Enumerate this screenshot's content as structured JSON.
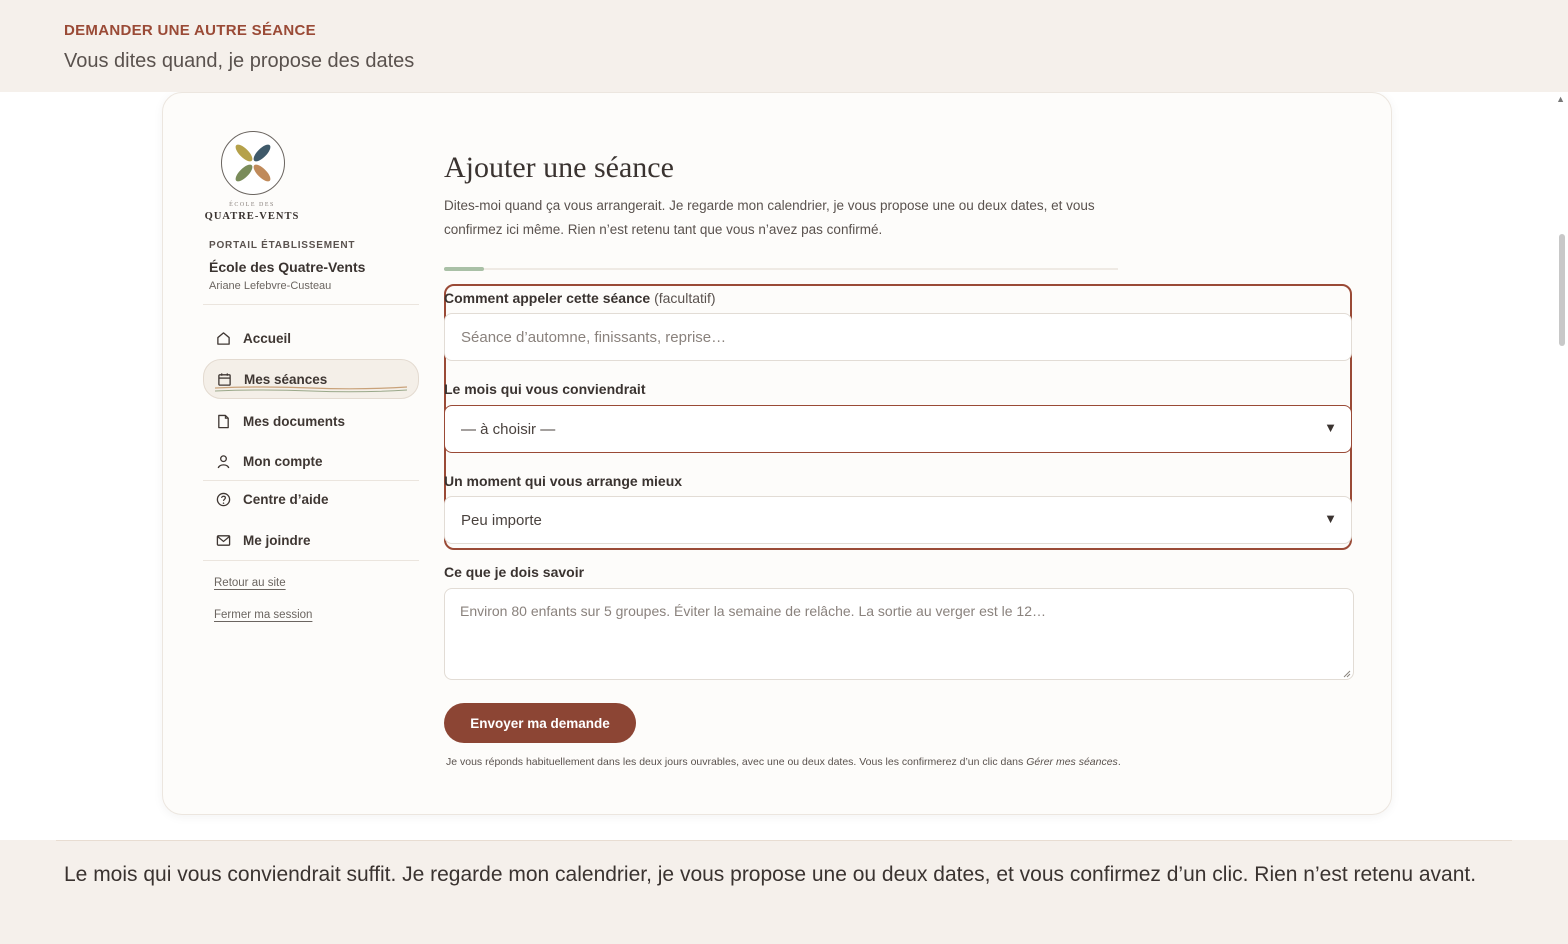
{
  "banner": {
    "eyebrow": "DEMANDER UNE AUTRE SÉANCE",
    "subtitle": "Vous dites quand, je propose des dates"
  },
  "sidebar": {
    "logo_small": "ÉCOLE DES",
    "logo_name": "QUATRE-VENTS",
    "portal_label": "PORTAIL ÉTABLISSEMENT",
    "school_name": "École des Quatre-Vents",
    "user_name": "Ariane Lefebvre-Custeau",
    "items": [
      {
        "label": "Accueil",
        "icon": "home-icon"
      },
      {
        "label": "Mes séances",
        "icon": "calendar-icon",
        "active": true
      },
      {
        "label": "Mes documents",
        "icon": "document-icon"
      },
      {
        "label": "Mon compte",
        "icon": "user-icon"
      },
      {
        "label": "Centre d’aide",
        "icon": "help-icon"
      },
      {
        "label": "Me joindre",
        "icon": "mail-icon"
      }
    ],
    "links": {
      "back_to_site": "Retour au site",
      "logout": "Fermer ma session"
    }
  },
  "main": {
    "title": "Ajouter une séance",
    "intro": "Dites-moi quand ça vous arrangerait. Je regarde mon calendrier, je vous propose une ou deux dates, et vous confirmez ici même. Rien n’est retenu tant que vous n’avez pas confirmé.",
    "progress": 0.06,
    "fields": {
      "name": {
        "label": "Comment appeler cette séance",
        "optional": "(facultatif)",
        "value": "",
        "placeholder": "Séance d’automne, finissants, reprise…"
      },
      "month": {
        "label": "Le mois qui vous conviendrait",
        "selected": "— à choisir —"
      },
      "moment": {
        "label": "Un moment qui vous arrange mieux",
        "selected": "Peu importe"
      },
      "notes": {
        "label": "Ce que je dois savoir",
        "value": "",
        "placeholder": "Environ 80 enfants sur 5 groupes. Éviter la semaine de relâche. La sortie au verger est le 12…"
      }
    },
    "submit_label": "Envoyer ma demande",
    "footnote_text": "Je vous réponds habituellement dans les deux jours ouvrables, avec une ou deux dates. Vous les confirmerez d’un clic dans ",
    "footnote_link": "Gérer mes séances",
    "footnote_end": "."
  },
  "bottom": {
    "text": "Le mois qui vous conviendrait suffit. Je regarde mon calendrier, je vous propose une ou deux dates, et vous confirmez d’un clic. Rien n’est retenu avant."
  },
  "colors": {
    "accent": "#9a4a36",
    "button": "#8c4534",
    "background": "#f5f0eb",
    "progress": "#a9c0a6"
  }
}
